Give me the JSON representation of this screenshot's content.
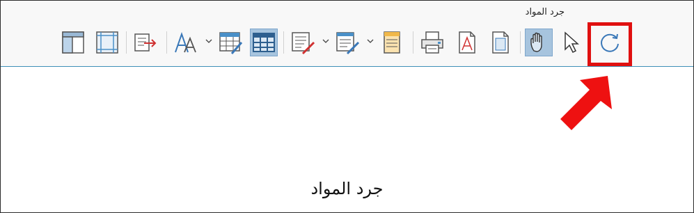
{
  "window": {
    "title": "جرد المواد"
  },
  "document": {
    "heading": "جرد المواد"
  },
  "toolbar": {
    "buttons": [
      {
        "name": "split-view-icon"
      },
      {
        "name": "page-margins-icon"
      },
      {
        "name": "export-icon"
      },
      {
        "name": "font-icon"
      },
      {
        "name": "edit-table-icon"
      },
      {
        "name": "grid-view-icon",
        "active": true
      },
      {
        "name": "edit-list-icon"
      },
      {
        "name": "edit-columns-icon"
      },
      {
        "name": "document-icon"
      },
      {
        "name": "print-icon"
      },
      {
        "name": "pdf-icon"
      },
      {
        "name": "page-icon"
      },
      {
        "name": "hand-tool-icon",
        "active": true
      },
      {
        "name": "pointer-tool-icon"
      },
      {
        "name": "refresh-icon"
      }
    ]
  },
  "colors": {
    "highlight": "#e01010",
    "accent": "#3f8fb8",
    "active_bg": "#a7c4de"
  }
}
